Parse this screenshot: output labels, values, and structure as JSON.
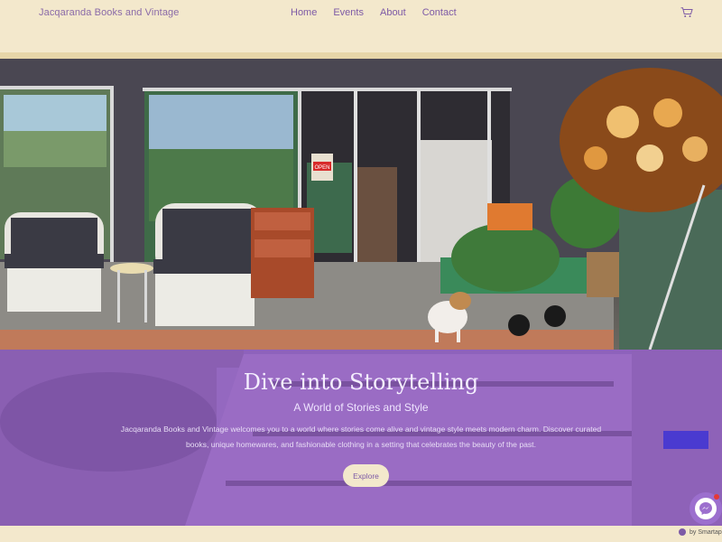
{
  "header": {
    "brand": "Jacqaranda Books and Vintage",
    "nav": [
      {
        "label": "Home"
      },
      {
        "label": "Events"
      },
      {
        "label": "About"
      },
      {
        "label": "Contact"
      }
    ],
    "cart_icon": "cart-icon"
  },
  "hero": {
    "open_sign": "OPEN"
  },
  "band": {
    "title": "Dive into Storytelling",
    "subtitle": "A World of Stories and Style",
    "body": "Jacqaranda Books and Vintage welcomes you to a world where stories come alive and vintage style meets modern charm. Discover curated books, unique homewares, and fashionable clothing in a setting that celebrates the beauty of the past.",
    "button": "Explore"
  },
  "chat": {
    "icon": "messenger-icon"
  },
  "footer": {
    "badge": "by Smartap"
  },
  "colors": {
    "cream": "#f3e8cc",
    "purple": "#8e62bc",
    "text_purple": "#7d5aa6"
  }
}
